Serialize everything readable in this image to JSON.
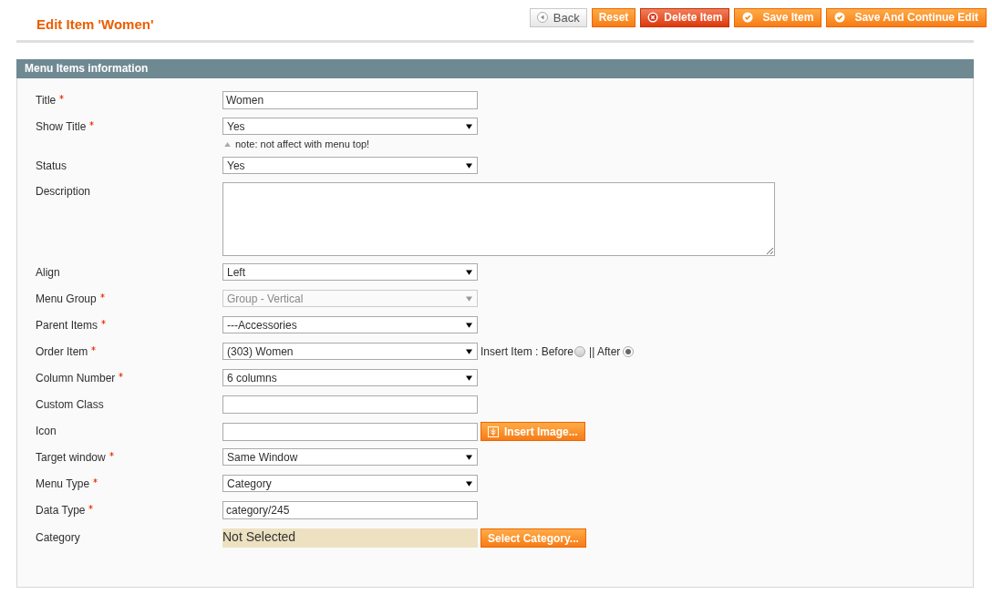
{
  "page_title": "Edit Item 'Women'",
  "actions": [
    {
      "label": "Back",
      "kind": "back"
    },
    {
      "label": "Reset",
      "kind": "plain"
    },
    {
      "label": "Delete Item",
      "kind": "delete"
    },
    {
      "label": "Save Item",
      "kind": "save"
    },
    {
      "label": "Save And Continue Edit",
      "kind": "save"
    }
  ],
  "section": {
    "title": "Menu Items information"
  },
  "fields": [
    {
      "label": "Title",
      "required": true,
      "kind": "text",
      "value": "Women"
    },
    {
      "label": "Show Title",
      "required": true,
      "kind": "select",
      "value": "Yes",
      "disabled": false,
      "note": "note: not affect with menu top!"
    },
    {
      "label": "Status",
      "required": false,
      "kind": "select",
      "value": "Yes",
      "disabled": false
    },
    {
      "label": "Description",
      "required": false,
      "kind": "textarea"
    },
    {
      "label": "Align",
      "required": false,
      "kind": "select",
      "value": "Left",
      "disabled": false
    },
    {
      "label": "Menu Group",
      "required": true,
      "kind": "select",
      "value": "Group - Vertical",
      "disabled": true
    },
    {
      "label": "Parent Items",
      "required": true,
      "kind": "select",
      "value": "---Accessories",
      "disabled": false
    },
    {
      "label": "Order Item",
      "required": true,
      "kind": "select",
      "value": "(303) Women",
      "disabled": false,
      "radios": [
        {
          "label": "Insert Item : Before",
          "selected": false
        },
        {
          "label": "|| After",
          "selected": true
        }
      ]
    },
    {
      "label": "Column Number",
      "required": true,
      "kind": "select",
      "value": "6 columns",
      "disabled": false
    },
    {
      "label": "Custom Class",
      "required": false,
      "kind": "text"
    },
    {
      "label": "Icon",
      "required": false,
      "kind": "text",
      "button": "Insert Image..."
    },
    {
      "label": "Target window",
      "required": true,
      "kind": "select",
      "value": "Same Window",
      "disabled": false
    },
    {
      "label": "Menu Type",
      "required": true,
      "kind": "select",
      "value": "Category",
      "disabled": false
    },
    {
      "label": "Data Type",
      "required": true,
      "kind": "text",
      "value": "category/245"
    },
    {
      "label": "Category",
      "required": false,
      "kind": "display",
      "value": "Not Selected",
      "button": "Select Category..."
    }
  ]
}
